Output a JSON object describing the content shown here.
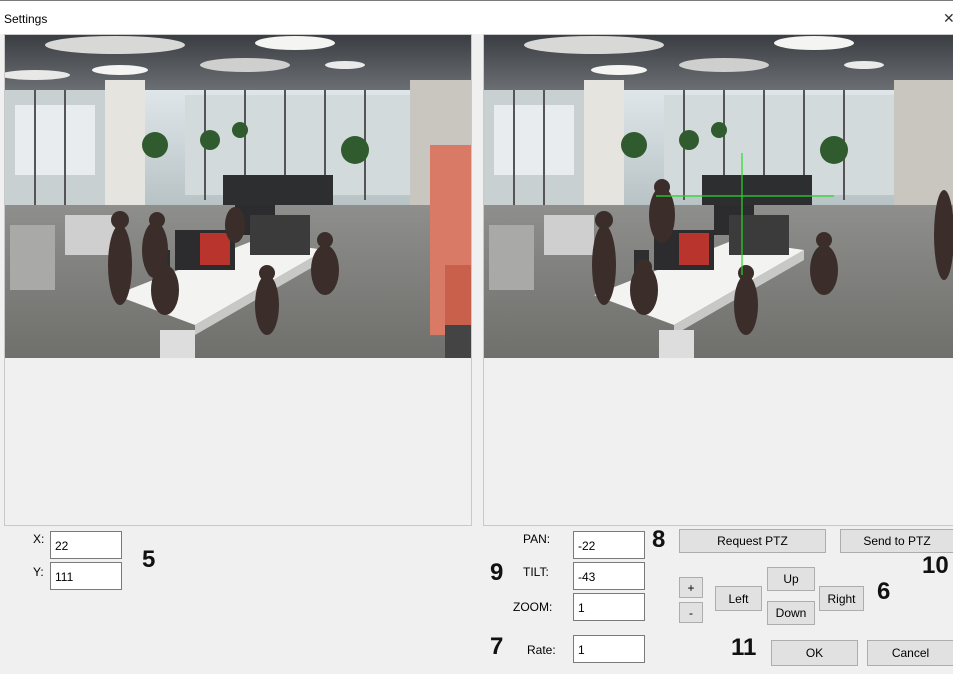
{
  "window": {
    "title": "Settings",
    "close_glyph": "✕"
  },
  "left": {
    "x_label": "X:",
    "x_value": "22",
    "y_label": "Y:",
    "y_value": "111"
  },
  "ptz": {
    "pan_label": "PAN:",
    "pan_value": "-22",
    "tilt_label": "TILT:",
    "tilt_value": "-43",
    "zoom_label": "ZOOM:",
    "zoom_value": "1",
    "rate_label": "Rate:",
    "rate_value": "1"
  },
  "buttons": {
    "request_ptz": "Request PTZ",
    "send_to_ptz": "Send to PTZ",
    "zoom_in": "+",
    "zoom_out": "-",
    "left": "Left",
    "up": "Up",
    "down": "Down",
    "right": "Right",
    "ok": "OK",
    "cancel": "Cancel"
  },
  "callouts": {
    "c5": "5",
    "c6": "6",
    "c7": "7",
    "c8": "8",
    "c9": "9",
    "c10": "10",
    "c11": "11"
  },
  "colors": {
    "crosshair": "#2bd62b",
    "window_bg": "#f0f0f0",
    "button_bg": "#e1e1e1"
  },
  "icons": {
    "close": "close-icon"
  }
}
